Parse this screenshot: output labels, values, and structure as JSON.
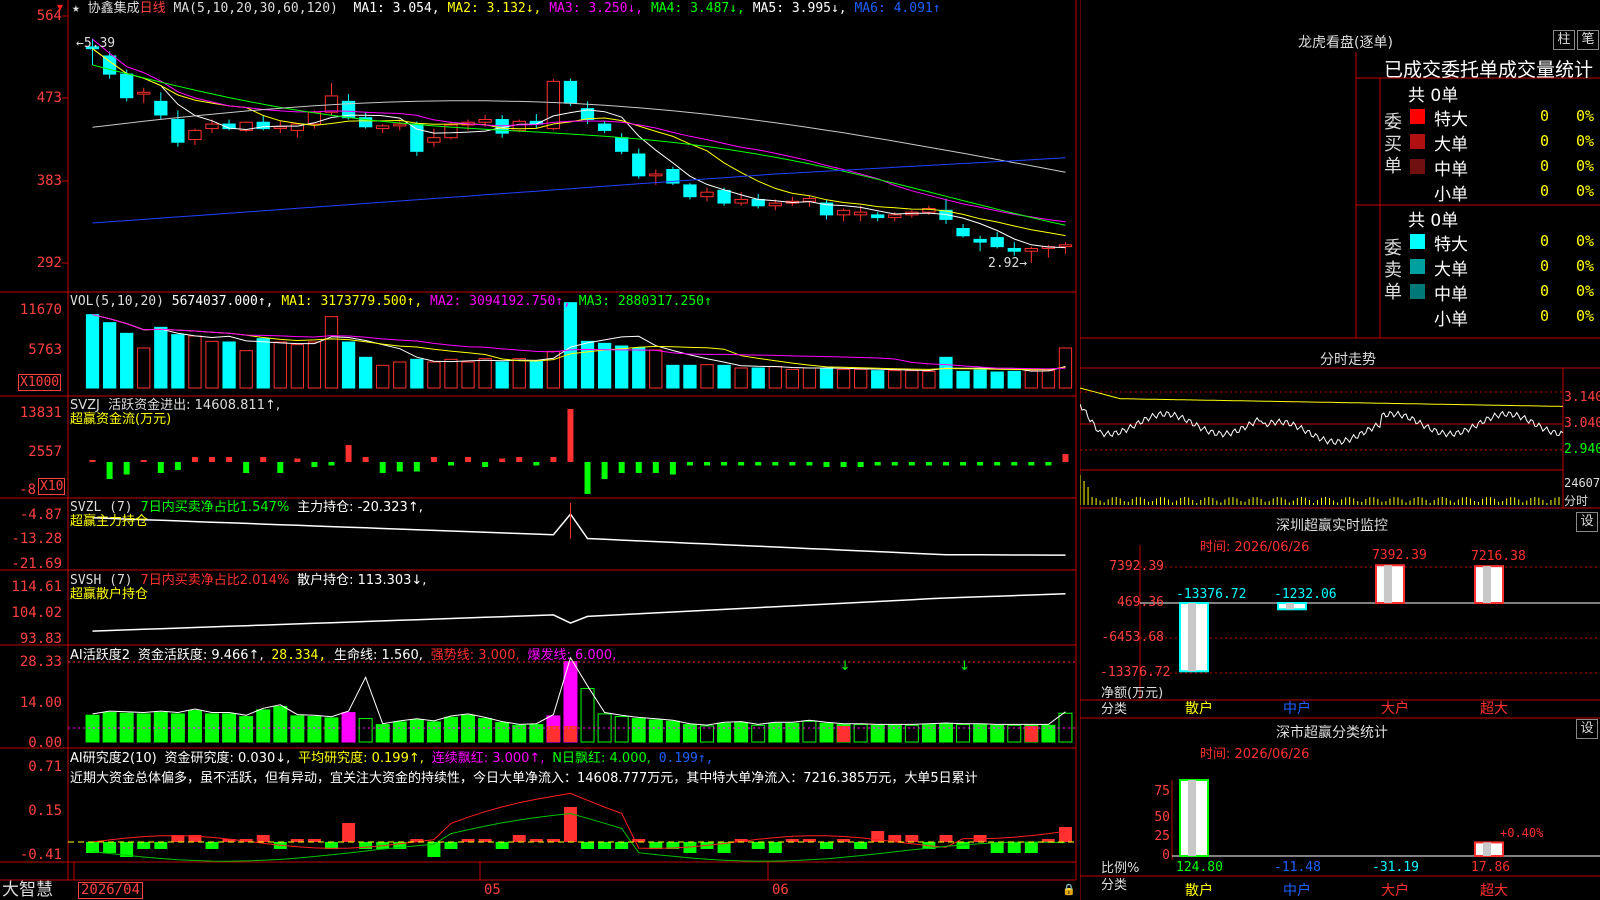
{
  "header": {
    "stock_name": "协鑫集成",
    "period": "日线",
    "ma_label": "MA(5,10,20,30,60,120)",
    "ma_values": [
      {
        "label": "MA1: 3.054,",
        "color": "#ffffff"
      },
      {
        "label": "MA2: 3.132↓,",
        "color": "#ffff00"
      },
      {
        "label": "MA3: 3.250↓,",
        "color": "#ff00ff"
      },
      {
        "label": "MA4: 3.487↓,",
        "color": "#00ff00"
      },
      {
        "label": "MA5: 3.995↓,",
        "color": "#ffffff"
      },
      {
        "label": "MA6: 4.091↑",
        "color": "#2060ff"
      }
    ]
  },
  "main_chart": {
    "y_ticks": [
      "564",
      "473",
      "383",
      "292"
    ],
    "high_note": "←5.39",
    "low_note": "2.92→",
    "candles": [
      [
        5.3,
        5.39,
        5.1,
        5.28
      ],
      [
        5.2,
        5.25,
        4.95,
        5.0
      ],
      [
        5.0,
        5.05,
        4.7,
        4.74
      ],
      [
        4.78,
        4.85,
        4.68,
        4.8
      ],
      [
        4.7,
        4.8,
        4.5,
        4.55
      ],
      [
        4.5,
        4.6,
        4.2,
        4.25
      ],
      [
        4.28,
        4.4,
        4.22,
        4.38
      ],
      [
        4.4,
        4.5,
        4.35,
        4.45
      ],
      [
        4.45,
        4.5,
        4.38,
        4.4
      ],
      [
        4.38,
        4.48,
        4.36,
        4.47
      ],
      [
        4.47,
        4.55,
        4.38,
        4.4
      ],
      [
        4.4,
        4.48,
        4.35,
        4.42
      ],
      [
        4.38,
        4.45,
        4.3,
        4.45
      ],
      [
        4.45,
        4.6,
        4.4,
        4.58
      ],
      [
        4.58,
        4.9,
        4.55,
        4.76
      ],
      [
        4.7,
        4.78,
        4.5,
        4.52
      ],
      [
        4.52,
        4.58,
        4.4,
        4.42
      ],
      [
        4.4,
        4.45,
        4.35,
        4.43
      ],
      [
        4.43,
        4.5,
        4.38,
        4.45
      ],
      [
        4.45,
        4.48,
        4.1,
        4.15
      ],
      [
        4.25,
        4.4,
        4.2,
        4.3
      ],
      [
        4.3,
        4.48,
        4.28,
        4.44
      ],
      [
        4.44,
        4.5,
        4.38,
        4.47
      ],
      [
        4.47,
        4.55,
        4.42,
        4.5
      ],
      [
        4.5,
        4.55,
        4.3,
        4.35
      ],
      [
        4.38,
        4.5,
        4.36,
        4.48
      ],
      [
        4.48,
        4.56,
        4.4,
        4.45
      ],
      [
        4.4,
        4.95,
        4.38,
        4.92
      ],
      [
        4.92,
        4.95,
        4.65,
        4.68
      ],
      [
        4.62,
        4.7,
        4.45,
        4.5
      ],
      [
        4.45,
        4.48,
        4.35,
        4.38
      ],
      [
        4.3,
        4.35,
        4.12,
        4.15
      ],
      [
        4.12,
        4.18,
        3.85,
        3.88
      ],
      [
        3.88,
        3.95,
        3.78,
        3.9
      ],
      [
        3.95,
        3.98,
        3.78,
        3.8
      ],
      [
        3.78,
        3.8,
        3.62,
        3.65
      ],
      [
        3.65,
        3.75,
        3.6,
        3.7
      ],
      [
        3.72,
        3.75,
        3.55,
        3.58
      ],
      [
        3.58,
        3.7,
        3.55,
        3.62
      ],
      [
        3.62,
        3.68,
        3.52,
        3.55
      ],
      [
        3.55,
        3.62,
        3.5,
        3.58
      ],
      [
        3.58,
        3.65,
        3.55,
        3.6
      ],
      [
        3.6,
        3.66,
        3.54,
        3.63
      ],
      [
        3.58,
        3.62,
        3.4,
        3.45
      ],
      [
        3.45,
        3.52,
        3.38,
        3.5
      ],
      [
        3.45,
        3.55,
        3.38,
        3.48
      ],
      [
        3.45,
        3.48,
        3.38,
        3.42
      ],
      [
        3.42,
        3.48,
        3.38,
        3.45
      ],
      [
        3.45,
        3.5,
        3.42,
        3.48
      ],
      [
        3.48,
        3.55,
        3.45,
        3.52
      ],
      [
        3.5,
        3.63,
        3.35,
        3.4
      ],
      [
        3.3,
        3.35,
        3.2,
        3.22
      ],
      [
        3.18,
        3.22,
        3.05,
        3.15
      ],
      [
        3.2,
        3.26,
        3.08,
        3.1
      ],
      [
        3.08,
        3.15,
        3.0,
        3.05
      ],
      [
        3.05,
        3.1,
        2.92,
        3.08
      ],
      [
        3.08,
        3.12,
        2.98,
        3.1
      ],
      [
        3.1,
        3.15,
        3.02,
        3.12
      ]
    ]
  },
  "vol_panel": {
    "title": "VOL(5,10,20)",
    "value": "5674037.000↑,",
    "ma1": "MA1: 3173779.500↑,",
    "ma2": "MA2: 3094192.750↑,",
    "ma3": "MA3: 2880317.250↑",
    "y_ticks": [
      "11670",
      "5763"
    ],
    "unit": "X1000"
  },
  "svzj_panel": {
    "title": "SVZJ  活跃资金进出: 14608.811↑,",
    "subtitle": "超赢资金流(万元)",
    "y_ticks": [
      "13831",
      "2557",
      "-8"
    ],
    "unit": "X10"
  },
  "svzl_panel": {
    "title": "SVZL (7)",
    "ratio": "7日内买卖净占比1.547%",
    "hold": "主力持仓: -20.323↑,",
    "subtitle": "超赢主力持仓",
    "y_ticks": [
      "-4.87",
      "-13.28",
      "-21.69"
    ]
  },
  "svsh_panel": {
    "title": "SVSH (7)",
    "ratio": "7日内买卖净占比2.014%",
    "hold": "散户持仓: 113.303↓,",
    "subtitle": "超赢散户持仓",
    "y_ticks": [
      "114.61",
      "104.02",
      "93.83"
    ]
  },
  "ai_active_panel": {
    "title": "AI活跃度2",
    "active": "资金活跃度: 9.466↑,",
    "v2": "28.334,",
    "life": "生命线: 1.560,",
    "strong": "强势线: 3.000,",
    "burst": "爆发线: 6.000,",
    "y_ticks": [
      "28.33",
      "14.00",
      "0.00"
    ]
  },
  "ai_research_panel": {
    "title": "AI研究度2(10)",
    "research": "资金研究度: 0.030↓,",
    "avg": "平均研究度: 0.199↑,",
    "cont": "连续飘红: 3.000↑,",
    "ndays": "N日飘红: 4.000,",
    "v5": "0.199↑,",
    "comment": "近期大资金总体偏多，虽不活跃，但有异动，宜关注大资金的持续性，今日大单净流入：14608.777万元，其中特大单净流入：7216.385万元，大单5日累计",
    "y_ticks": [
      "0.71",
      "0.15",
      "-0.41"
    ]
  },
  "bottom_axis": {
    "brand": "大智慧",
    "dates": [
      "2026/04",
      "05",
      "06"
    ]
  },
  "right_panel": {
    "lhb_title": "龙虎看盘(逐单)",
    "btn_zhu": "柱",
    "btn_bi": "笔",
    "lhb_header": "已成交委托单成交量统计",
    "buy_side": "委买单",
    "sell_side": "委卖单",
    "buy_total": "共 0单",
    "sell_total": "共 0单",
    "buy_rows": [
      {
        "label": "特大",
        "count": "0",
        "pct": "0%",
        "color": "#ff0000"
      },
      {
        "label": "大单",
        "count": "0",
        "pct": "0%",
        "color": "#b01010"
      },
      {
        "label": "中单",
        "count": "0",
        "pct": "0%",
        "color": "#701010"
      },
      {
        "label": "小单",
        "count": "0",
        "pct": "0%",
        "color": ""
      }
    ],
    "sell_rows": [
      {
        "label": "特大",
        "count": "0",
        "pct": "0%",
        "color": "#00ffff"
      },
      {
        "label": "大单",
        "count": "0",
        "pct": "0%",
        "color": "#00a0a0"
      },
      {
        "label": "中单",
        "count": "0",
        "pct": "0%",
        "color": "#007878"
      },
      {
        "label": "小单",
        "count": "0",
        "pct": "0%",
        "color": ""
      }
    ],
    "intraday_title": "分时走势",
    "intraday_y": [
      "3.140",
      "3.040",
      "2.940"
    ],
    "intraday_vol": "24607",
    "intraday_vol_unit": "分时",
    "sz_monitor_title": "深圳超赢实时监控",
    "sz_time": "时间: 2026/06/26",
    "sz_y": [
      "7392.39",
      "469.36",
      "-6453.68",
      "-13376.72"
    ],
    "sz_net_label": "净额(万元)",
    "sz_cat_label": "分类",
    "sz_values": [
      {
        "label": "-13376.72",
        "value": -13376.72,
        "color": "#00ffff"
      },
      {
        "label": "-1232.06",
        "value": -1232.06,
        "color": "#00ffff"
      },
      {
        "label": "7392.39",
        "value": 7392.39,
        "color": "#ff3030"
      },
      {
        "label": "7216.38",
        "value": 7216.38,
        "color": "#ff3030"
      }
    ],
    "categories": [
      "散户",
      "中户",
      "大户",
      "超大"
    ],
    "cat_colors": [
      "#ffff00",
      "#2060ff",
      "#ff3030",
      "#ff3030"
    ],
    "class_title": "深市超赢分类统计",
    "class_time": "时间: 2026/06/26",
    "class_y": [
      "75",
      "50",
      "25",
      "0"
    ],
    "class_ratio_label": "比例%",
    "class_cat_label": "分类",
    "class_values": [
      {
        "label": "124.80",
        "value": 124.8,
        "color": "#00ff00"
      },
      {
        "label": "-11.48",
        "value": -11.48,
        "color": "#2060ff"
      },
      {
        "label": "-31.19",
        "value": -31.19,
        "color": "#00ffff"
      },
      {
        "label": "17.86",
        "value": 17.86,
        "color": "#ff3030"
      }
    ],
    "class_note": "+0.40%",
    "btn_set": "设"
  }
}
